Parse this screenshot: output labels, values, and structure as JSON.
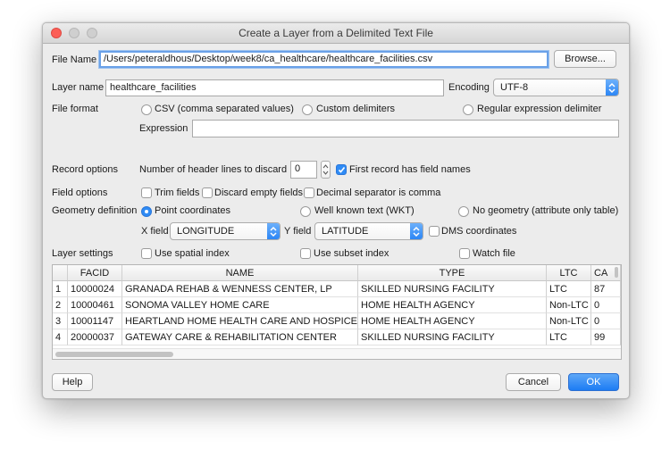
{
  "window": {
    "title": "Create a Layer from a Delimited Text File"
  },
  "file_name": {
    "label": "File Name",
    "value": "/Users/peteraldhous/Desktop/week8/ca_healthcare/healthcare_facilities.csv",
    "browse": "Browse..."
  },
  "layer_name": {
    "label": "Layer name",
    "value": "healthcare_facilities"
  },
  "encoding": {
    "label": "Encoding",
    "value": "UTF-8"
  },
  "file_format": {
    "label": "File format",
    "options": [
      "CSV (comma separated values)",
      "Custom delimiters",
      "Regular expression delimiter"
    ],
    "expression_label": "Expression",
    "expression_value": ""
  },
  "record_options": {
    "label": "Record options",
    "header_lines_label": "Number of header lines to discard",
    "header_lines_value": "0",
    "first_record_label": "First record has field names",
    "first_record_checked": true
  },
  "field_options": {
    "label": "Field options",
    "trim": "Trim fields",
    "discard_empty": "Discard empty fields",
    "decimal_comma": "Decimal separator is comma"
  },
  "geometry": {
    "label": "Geometry definition",
    "options": [
      "Point coordinates",
      "Well known text (WKT)",
      "No geometry (attribute only table)"
    ],
    "selected": "Point coordinates",
    "x_label": "X field",
    "x_value": "LONGITUDE",
    "y_label": "Y field",
    "y_value": "LATITUDE",
    "dms": "DMS coordinates"
  },
  "layer_settings": {
    "label": "Layer settings",
    "spatial_index": "Use spatial index",
    "subset_index": "Use subset index",
    "watch_file": "Watch file"
  },
  "table": {
    "columns": [
      "FACID",
      "NAME",
      "TYPE",
      "LTC",
      "CA"
    ],
    "rows": [
      {
        "num": "1",
        "facid": "10000024",
        "name": "GRANADA REHAB & WENNESS CENTER, LP",
        "type": "SKILLED NURSING FACILITY",
        "ltc": "LTC",
        "ca": "87"
      },
      {
        "num": "2",
        "facid": "10000461",
        "name": "SONOMA VALLEY HOME CARE",
        "type": "HOME HEALTH AGENCY",
        "ltc": "Non-LTC",
        "ca": "0"
      },
      {
        "num": "3",
        "facid": "10001147",
        "name": "HEARTLAND HOME HEALTH CARE AND HOSPICE",
        "type": "HOME HEALTH AGENCY",
        "ltc": "Non-LTC",
        "ca": "0"
      },
      {
        "num": "4",
        "facid": "20000037",
        "name": "GATEWAY CARE & REHABILITATION CENTER",
        "type": "SKILLED NURSING FACILITY",
        "ltc": "LTC",
        "ca": "99"
      }
    ]
  },
  "buttons": {
    "help": "Help",
    "cancel": "Cancel",
    "ok": "OK"
  }
}
